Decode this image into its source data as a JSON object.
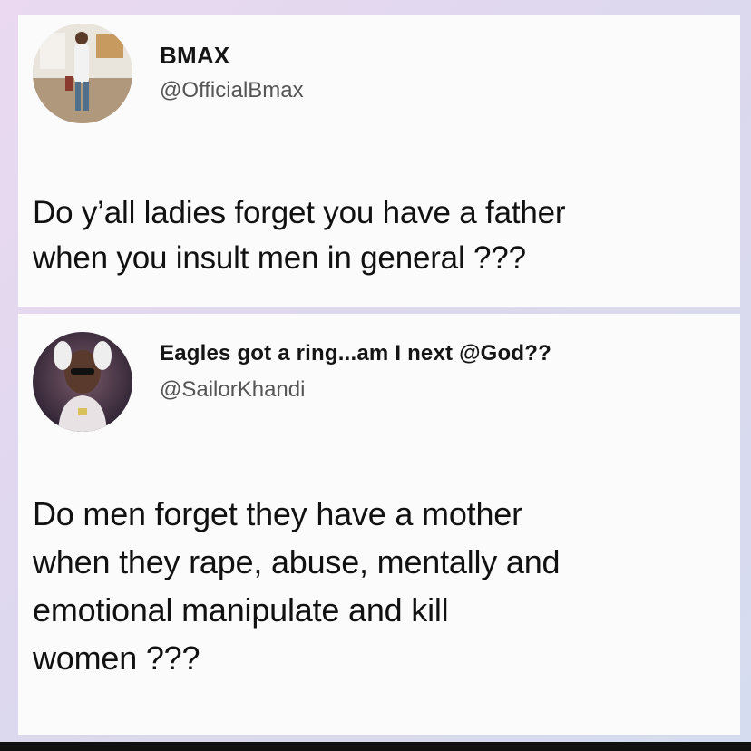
{
  "tweets": [
    {
      "display_name": "BMAX",
      "handle": "@OfficialBmax",
      "text_lines": [
        "Do y’all ladies forget you have a father",
        "when you insult men in general ???"
      ],
      "avatar_icon": "profile-photo-icon"
    },
    {
      "display_name": "Eagles got a ring...am I next @God??",
      "handle": "@SailorKhandi",
      "text_lines": [
        "Do men forget they have a mother",
        "when they rape, abuse, mentally and",
        "emotional manipulate and kill",
        "women ???"
      ],
      "avatar_icon": "profile-photo-icon"
    }
  ],
  "colors": {
    "frame": "#e0d8ee",
    "card": "#fbfbfc",
    "text": "#111111",
    "handle": "#555555"
  }
}
